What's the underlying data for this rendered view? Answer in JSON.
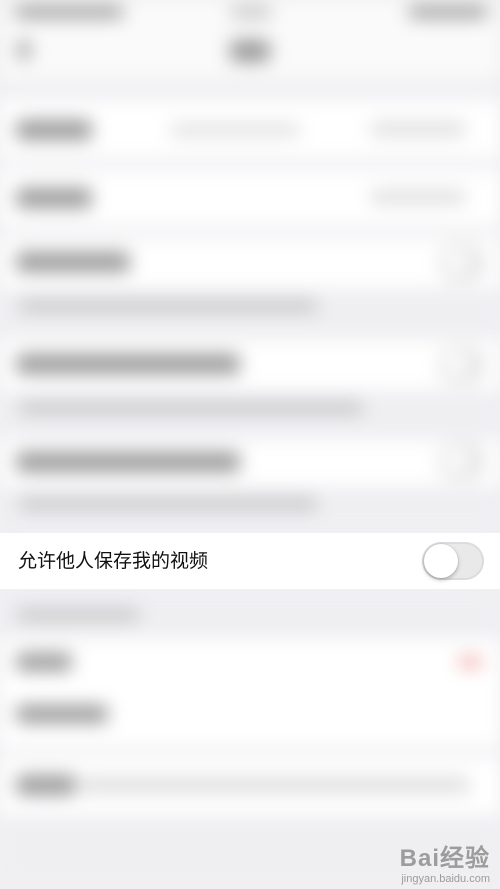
{
  "setting": {
    "label": "允许他人保存我的视频",
    "enabled": false
  },
  "watermark": {
    "logo": "Bai经验",
    "url": "jingyan.baidu.com"
  }
}
